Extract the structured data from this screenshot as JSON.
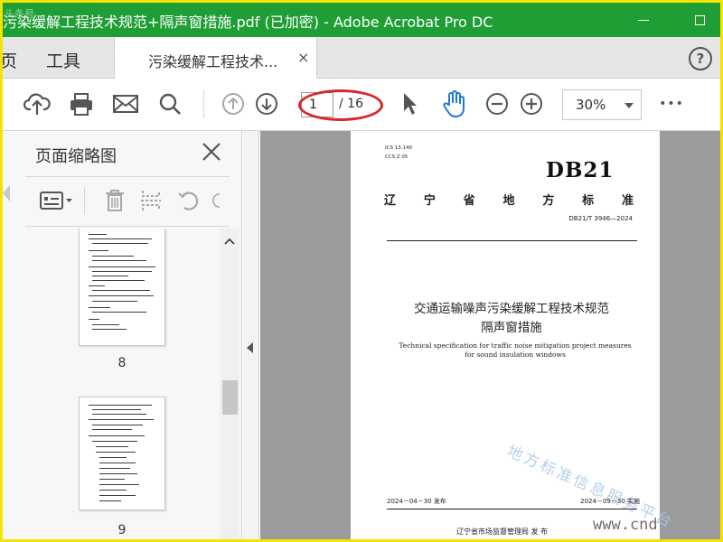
{
  "window": {
    "title": "污染缓解工程技术规范+隔声窗措施.pdf (已加密)  - Adobe Acrobat Pro DC"
  },
  "tabs": {
    "nav": [
      {
        "label": "页"
      },
      {
        "label": "工具"
      }
    ],
    "document_tab": {
      "label": "污染缓解工程技术...",
      "close_glyph": "×"
    },
    "help_glyph": "?"
  },
  "toolbar": {
    "icons": [
      "upload-cloud-icon",
      "print-icon",
      "mail-icon",
      "search-icon",
      "page-up-icon",
      "page-down-icon",
      "select-cursor-icon",
      "hand-tool-icon",
      "zoom-out-icon",
      "zoom-in-icon",
      "more-icon"
    ],
    "current_page": "1",
    "total_pages": "/ 16",
    "zoom": "30%",
    "more_glyph": "•••",
    "highlight_color": "#d9262b"
  },
  "sidebar": {
    "title": "页面缩略图",
    "tools": [
      "thumbnail-options-icon",
      "delete-page-icon",
      "extract-page-icon",
      "rotate-ccw-icon",
      "rotate-cw-icon"
    ],
    "thumbnails": [
      {
        "page_label": "8"
      },
      {
        "page_label": "9"
      }
    ]
  },
  "document": {
    "ics": "ICS  13.140",
    "ccs": "CCS  Z 05",
    "logo": "DB21",
    "province_chars": [
      "辽",
      "宁",
      "省",
      "地",
      "方",
      "标",
      "准"
    ],
    "standard_number": "DB21/T 3946—2024",
    "title_cn": "交通运输噪声污染缓解工程技术规范",
    "subtitle_cn": "隔声窗措施",
    "title_en": "Technical specification for traffic noise mitigation project measures for sound insulation windows",
    "watermark": "地方标准信息服务平台",
    "publish_date": "2024－04－30 发布",
    "implement_date": "2024－05－30 实施",
    "issuer": "辽宁省市场监督管理局    发 布"
  },
  "overlays": {
    "corner_top_left": "头条号",
    "corner_bottom_right": "www.cnd"
  },
  "colors": {
    "title_bar": "#1e9e35",
    "frame_border": "#f3e500"
  }
}
